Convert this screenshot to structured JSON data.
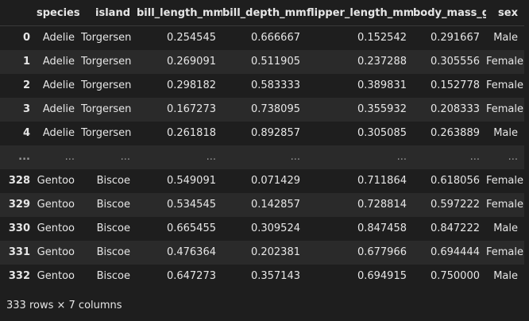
{
  "table": {
    "columns": [
      "species",
      "island",
      "bill_length_mm",
      "bill_depth_mm",
      "flipper_length_mm",
      "body_mass_g",
      "sex"
    ],
    "rows": [
      {
        "index": "0",
        "cells": [
          "Adelie",
          "Torgersen",
          "0.254545",
          "0.666667",
          "0.152542",
          "0.291667",
          "Male"
        ]
      },
      {
        "index": "1",
        "cells": [
          "Adelie",
          "Torgersen",
          "0.269091",
          "0.511905",
          "0.237288",
          "0.305556",
          "Female"
        ]
      },
      {
        "index": "2",
        "cells": [
          "Adelie",
          "Torgersen",
          "0.298182",
          "0.583333",
          "0.389831",
          "0.152778",
          "Female"
        ]
      },
      {
        "index": "3",
        "cells": [
          "Adelie",
          "Torgersen",
          "0.167273",
          "0.738095",
          "0.355932",
          "0.208333",
          "Female"
        ]
      },
      {
        "index": "4",
        "cells": [
          "Adelie",
          "Torgersen",
          "0.261818",
          "0.892857",
          "0.305085",
          "0.263889",
          "Male"
        ]
      },
      {
        "index": "...",
        "cells": [
          "...",
          "...",
          "...",
          "...",
          "...",
          "...",
          "..."
        ],
        "ellipsis": true
      },
      {
        "index": "328",
        "cells": [
          "Gentoo",
          "Biscoe",
          "0.549091",
          "0.071429",
          "0.711864",
          "0.618056",
          "Female"
        ]
      },
      {
        "index": "329",
        "cells": [
          "Gentoo",
          "Biscoe",
          "0.534545",
          "0.142857",
          "0.728814",
          "0.597222",
          "Female"
        ]
      },
      {
        "index": "330",
        "cells": [
          "Gentoo",
          "Biscoe",
          "0.665455",
          "0.309524",
          "0.847458",
          "0.847222",
          "Male"
        ]
      },
      {
        "index": "331",
        "cells": [
          "Gentoo",
          "Biscoe",
          "0.476364",
          "0.202381",
          "0.677966",
          "0.694444",
          "Female"
        ]
      },
      {
        "index": "332",
        "cells": [
          "Gentoo",
          "Biscoe",
          "0.647273",
          "0.357143",
          "0.694915",
          "0.750000",
          "Male"
        ]
      }
    ]
  },
  "footer": {
    "shape_text": "333 rows × 7 columns"
  }
}
